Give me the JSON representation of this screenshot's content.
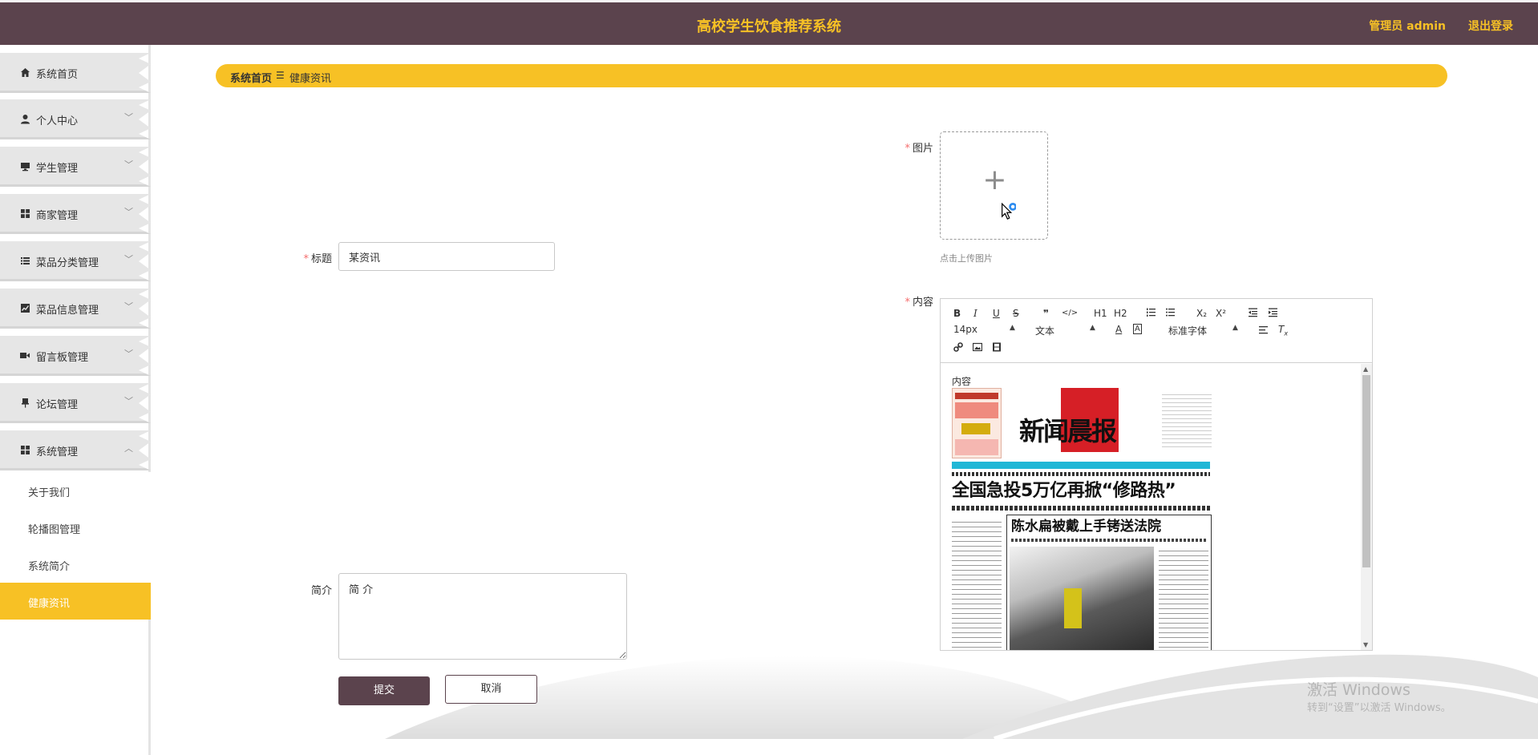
{
  "header": {
    "title": "高校学生饮食推荐系统",
    "admin": "管理员 admin",
    "logout": "退出登录"
  },
  "sidebar": {
    "items": [
      {
        "label": "系统首页",
        "icon": "home-icon"
      },
      {
        "label": "个人中心",
        "icon": "user-icon"
      },
      {
        "label": "学生管理",
        "icon": "monitor-icon"
      },
      {
        "label": "商家管理",
        "icon": "grid-icon"
      },
      {
        "label": "菜品分类管理",
        "icon": "list-icon"
      },
      {
        "label": "菜品信息管理",
        "icon": "chart-icon"
      },
      {
        "label": "留言板管理",
        "icon": "video-icon"
      },
      {
        "label": "论坛管理",
        "icon": "pin-icon"
      },
      {
        "label": "系统管理",
        "icon": "grid-icon"
      }
    ],
    "submenu": [
      {
        "label": "关于我们"
      },
      {
        "label": "轮播图管理"
      },
      {
        "label": "系统简介"
      },
      {
        "label": "健康资讯",
        "active": true
      }
    ]
  },
  "breadcrumb": {
    "home": "系统首页",
    "separator": "☰",
    "current": "健康资讯"
  },
  "form": {
    "title_label": "标题",
    "title_value": "某资讯",
    "image_label": "图片",
    "upload_tip": "点击上传图片",
    "content_label": "内容",
    "summary_label": "简介",
    "summary_value": "简 介",
    "submit": "提交",
    "cancel": "取消"
  },
  "editor": {
    "content_text": "内容",
    "font_size": "14px",
    "paragraph": "文本",
    "font_family": "标准字体",
    "tools": {
      "bold": "B",
      "italic": "I",
      "underline": "U",
      "strike": "S",
      "quote": "❞",
      "code": "</>",
      "h1": "H1",
      "h2": "H2",
      "sub": "X₂",
      "sup": "X²"
    },
    "newspaper": {
      "masthead": "新闻晨报",
      "headline": "全国急投5万亿再掀“修路热”",
      "subhead": "陈水扁被戴上手铐送法院"
    }
  },
  "watermark": {
    "line1": "激活 Windows",
    "line2": "转到“设置”以激活 Windows。"
  },
  "colors": {
    "header_bg": "#5b434d",
    "accent": "#f7c125",
    "primary_button": "#5b434d"
  }
}
